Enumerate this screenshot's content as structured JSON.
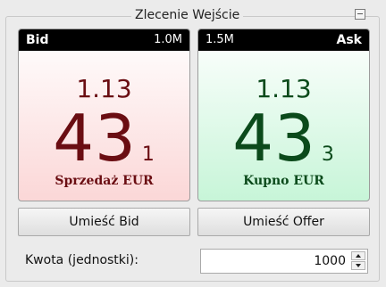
{
  "panel": {
    "title": "Zlecenie Wejście",
    "collapse_icon": "collapse-icon"
  },
  "bid": {
    "header_left": "Bid",
    "header_right": "1.0M",
    "price_top": "1.13",
    "price_big": "43",
    "price_sub": "1",
    "caption": "Sprzedaż EUR",
    "button_label": "Umieść Bid"
  },
  "ask": {
    "header_left": "1.5M",
    "header_right": "Ask",
    "price_top": "1.13",
    "price_big": "43",
    "price_sub": "3",
    "caption": "Kupno EUR",
    "button_label": "Umieść Offer"
  },
  "quantity": {
    "label": "Kwota (jednostki):",
    "value": "1000"
  },
  "colors": {
    "bid_text": "#6a0d12",
    "ask_text": "#0b4a1b",
    "header_bg": "#000000"
  }
}
